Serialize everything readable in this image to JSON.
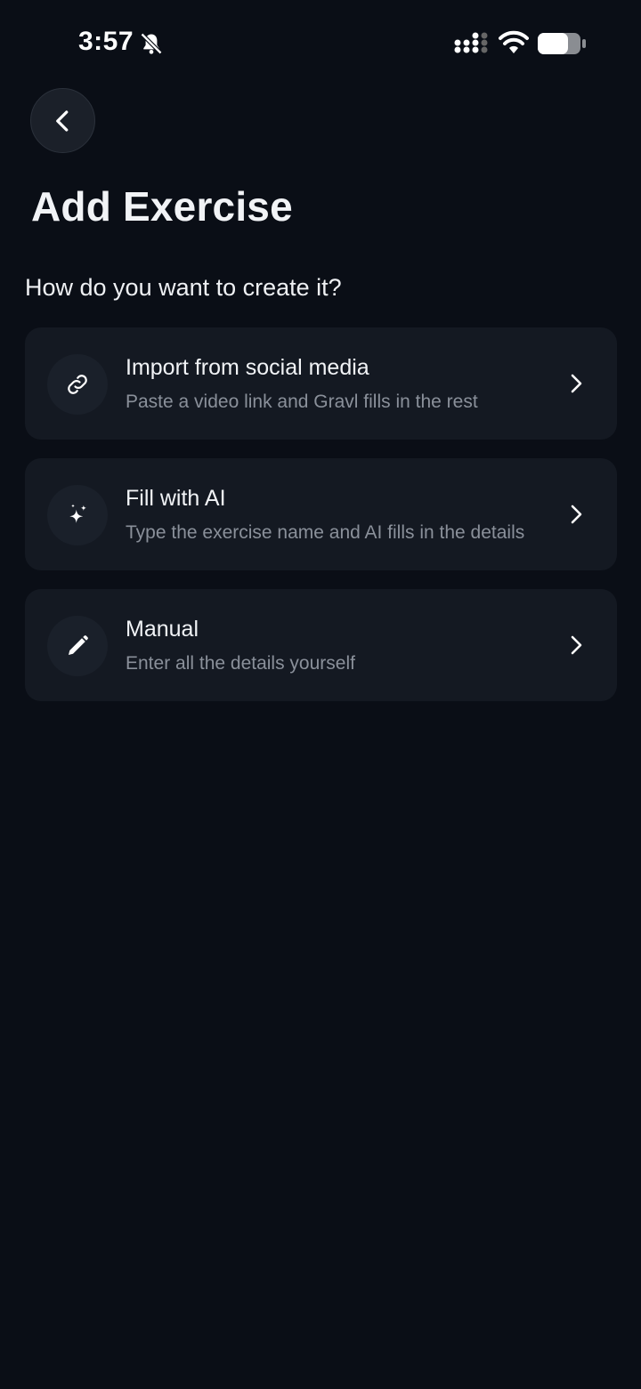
{
  "status_bar": {
    "time": "3:57",
    "icons": [
      "bell-slash-icon",
      "signal-icon",
      "wifi-icon",
      "battery-icon"
    ]
  },
  "header": {
    "back_icon": "chevron-left-icon",
    "title": "Add Exercise"
  },
  "prompt": "How do you want to create it?",
  "options": [
    {
      "icon": "link-icon",
      "title": "Import from social media",
      "description": "Paste a video link and Gravl fills in the rest"
    },
    {
      "icon": "sparkles-icon",
      "title": "Fill with AI",
      "description": "Type the exercise name and AI fills in the details"
    },
    {
      "icon": "pencil-icon",
      "title": "Manual",
      "description": "Enter all the details yourself"
    }
  ],
  "colors": {
    "background": "#0a0e16",
    "card": "#141922",
    "primary_text": "#f1f3f6",
    "secondary_text": "#8a909a"
  }
}
